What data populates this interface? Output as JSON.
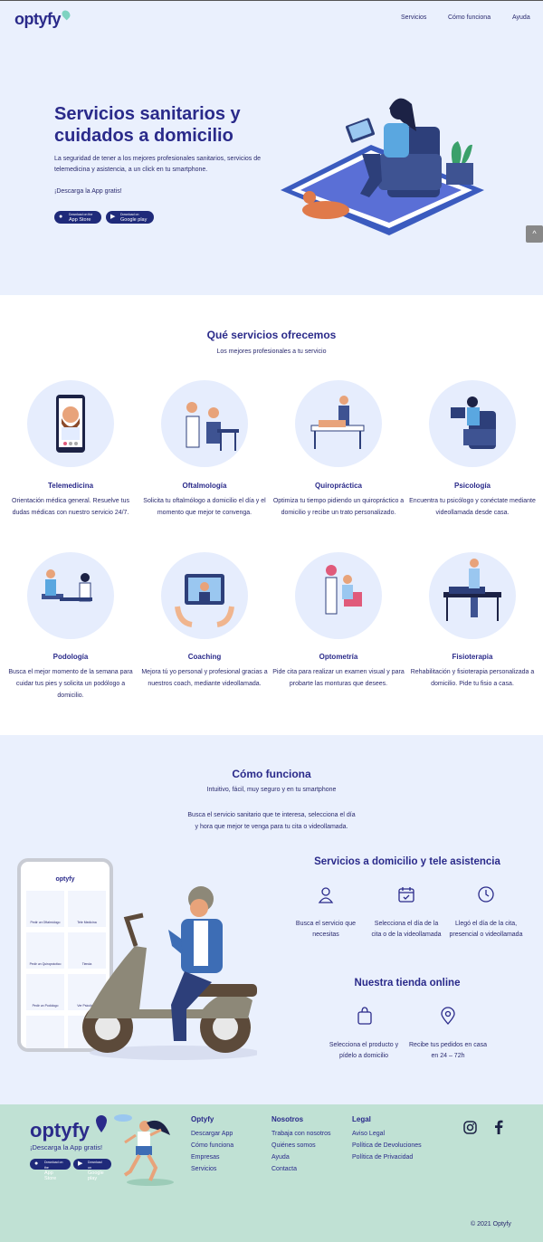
{
  "header": {
    "logo": "optyfy",
    "nav": [
      {
        "label": "Servicios"
      },
      {
        "label": "Cómo funciona"
      },
      {
        "label": "Ayuda"
      }
    ]
  },
  "hero": {
    "title": "Servicios sanitarios y cuidados a domicilio",
    "subtitle": "La seguridad de tener a los mejores profesionales sanitarios, servicios de telemedicina y asistencia, a un click en tu smartphone.",
    "cta": "¡Descarga la App gratis!",
    "app_store": {
      "small": "Download on the",
      "label": "App Store"
    },
    "google_play": {
      "small": "Download on",
      "label": "Google play"
    }
  },
  "services": {
    "title": "Qué servicios ofrecemos",
    "subtitle": "Los mejores profesionales a tu servicio",
    "items": [
      {
        "name": "Telemedicina",
        "desc": "Orientación médica general. Resuelve tus dudas médicas con nuestro servicio 24/7."
      },
      {
        "name": "Oftalmología",
        "desc": "Solicita tu oftalmólogo a domicilio el día y el momento que mejor te convenga."
      },
      {
        "name": "Quiropráctica",
        "desc": "Optimiza tu tiempo pidiendo un quiropráctico a domicilio y recibe un trato personalizado."
      },
      {
        "name": "Psicología",
        "desc": "Encuentra tu psicólogo y conéctate mediante videollamada desde casa."
      },
      {
        "name": "Podología",
        "desc": "Busca el mejor momento de la semana para cuidar tus pies y solicita un podólogo a domicilio."
      },
      {
        "name": "Coaching",
        "desc": "Mejora tú yo personal y profesional gracias a nuestros coach, mediante videollamada."
      },
      {
        "name": "Optometría",
        "desc": "Pide cita para realizar un examen visual y para probarte las monturas que desees."
      },
      {
        "name": "Fisioterapia",
        "desc": "Rehabilitación y fisioterapia personalizada a domicilio. Pide tu fisio a casa."
      }
    ]
  },
  "how": {
    "title": "Cómo funciona",
    "subtitle": "Intuitivo, fácil, muy seguro y en tu smartphone",
    "text_line1": "Busca el servicio sanitario que te interesa, selecciona el día",
    "text_line2": "y hora que mejor te venga para tu cita o videollamada.",
    "phone_logo": "optyfy",
    "phone_tiles": [
      "Pedir un Oftalmólogo",
      "Tele Medicina",
      "Pedir un Quiropráctico",
      "Tienda",
      "Pedir un Podólogo",
      "Ver Psicólogo"
    ],
    "home_title": "Servicios a domicilio y tele asistencia",
    "home_steps": [
      {
        "icon": "user-icon",
        "line1": "Busca el servicio que",
        "line2": "necesitas"
      },
      {
        "icon": "calendar-icon",
        "line1": "Selecciona el día de la",
        "line2": "cita o de la videollamada"
      },
      {
        "icon": "clock-icon",
        "line1": "Llegó el día de la cita,",
        "line2": "presencial o videollamada"
      }
    ],
    "shop_title": "Nuestra tienda online",
    "shop_steps": [
      {
        "icon": "shopping-bag-icon",
        "line1": "Selecciona el producto y",
        "line2": "pídelo a domicilio"
      },
      {
        "icon": "location-pin-icon",
        "line1": "Recibe tus pedidos en casa",
        "line2": "en 24 – 72h"
      }
    ]
  },
  "footer": {
    "logo": "optyfy",
    "cta": "¡Descarga la App gratis!",
    "columns": [
      {
        "title": "Optyfy",
        "links": [
          "Descargar App",
          "Cómo funciona",
          "Empresas",
          "Servicios"
        ]
      },
      {
        "title": "Nosotros",
        "links": [
          "Trabaja con nosotros",
          "Quiénes somos",
          "Ayuda",
          "Contacta"
        ]
      },
      {
        "title": "Legal",
        "links": [
          "Aviso Legal",
          "Política de Devoluciones",
          "Política de Privacidad"
        ]
      }
    ],
    "copyright": "© 2021 Optyfy"
  },
  "colors": {
    "brand": "#2a2a8a",
    "hero_bg": "#eaf0fd",
    "footer_bg": "#c0e1d4",
    "accent": "#3d6db5"
  }
}
